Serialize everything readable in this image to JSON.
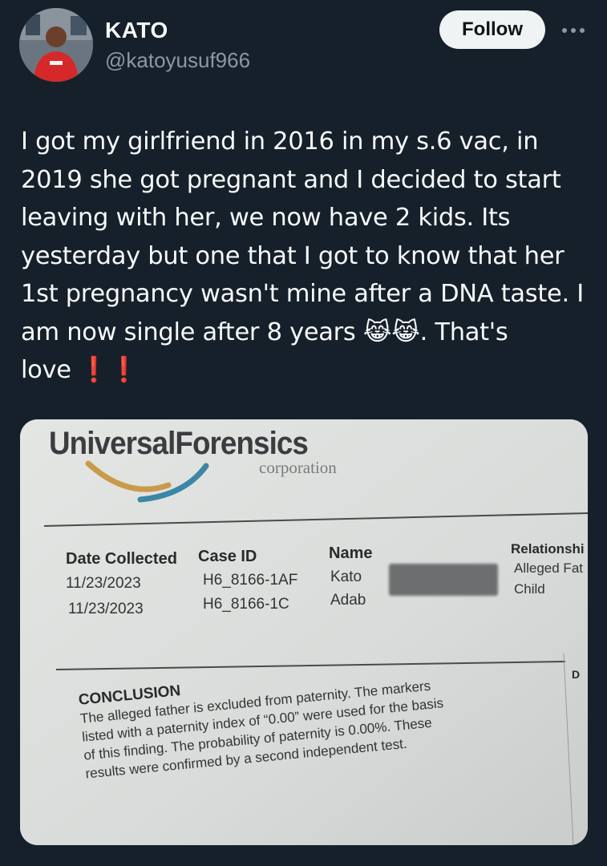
{
  "author": {
    "name": "KATO",
    "handle": "@katoyusuf966"
  },
  "actions": {
    "follow_label": "Follow"
  },
  "tweet": {
    "text": "I got my girlfriend in 2016 in my s.6 vac, in\n2019 she got pregnant and I decided to start\nleaving with her, we now have 2 kids. Its\nyesterday but one that I got to know that her\n1st pregnancy wasn't mine after a DNA taste. I\nam now single after 8 years 😹😹. That's\nlove ❗❗"
  },
  "document": {
    "logo_title": "UniversalForensics",
    "logo_subtitle": "corporation",
    "headers": {
      "date": "Date Collected",
      "case": "Case ID",
      "name": "Name",
      "relationship": "Relationshi"
    },
    "rows": [
      {
        "date": "11/23/2023",
        "case": "H6_8166-1AF",
        "name": "Kato",
        "relationship": "Alleged Fat"
      },
      {
        "date": "11/23/2023",
        "case": "H6_8166-1C",
        "name": "Adab",
        "relationship": "Child"
      }
    ],
    "side_marker": "D",
    "conclusion_title": "CONCLUSION",
    "conclusion_lines": [
      "The alleged father is excluded from paternity. The markers",
      "listed with a paternity index of “0.00” were used for the basis",
      "of this finding. The probability of paternity is 0.00%. These",
      "results were confirmed by a second independent test."
    ]
  },
  "colors": {
    "background": "#15202b",
    "text": "#f7f9f9",
    "secondary": "#8b98a5",
    "follow_bg": "#eff3f4",
    "paper": "#dcdcd8"
  }
}
